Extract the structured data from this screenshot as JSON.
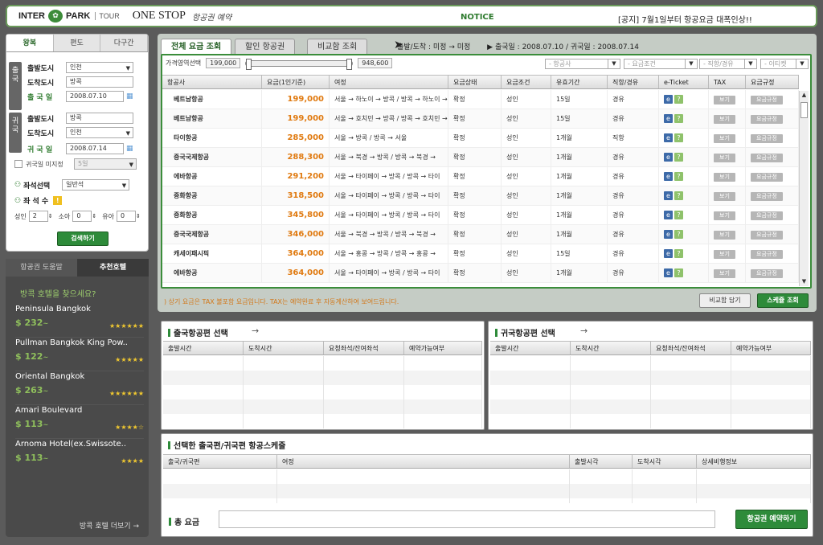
{
  "header": {
    "logo_inter": "INTER",
    "logo_ball": "✿",
    "logo_park": "PARK",
    "logo_tour": "TOUR",
    "logo_onestop": "ONE STOP",
    "logo_sub": "항공권 예약",
    "notice_label": "NOTICE",
    "notice_text": "[공지] 7월1일부터 항공요금 대폭인상!!"
  },
  "left": {
    "tabs": [
      "왕복",
      "편도",
      "다구간"
    ],
    "out_bar": "출국",
    "ret_bar": "귀국",
    "depart_city_label": "출발도시",
    "arrive_city_label": "도착도시",
    "out_date_label": "출 국 일",
    "out_depart_city": "인천",
    "out_arrive_city": "방콕",
    "out_date": "2008.07.10",
    "ret_depart_city_label": "출발도시",
    "ret_arrive_city_label": "도착도시",
    "ret_date_label": "귀 국 일",
    "ret_depart_city": "방콕",
    "ret_arrive_city": "인천",
    "ret_date": "2008.07.14",
    "undecided_label": "귀국일 미지정",
    "undecided_days": "5일",
    "seat_label": "좌석선택",
    "seat_value": "일반석",
    "seatcount_label": "좌 석 수",
    "adult_label": "성인",
    "adult_value": "2",
    "child_label": "소아",
    "child_value": "0",
    "infant_label": "유아",
    "infant_value": "0",
    "search_button": "검색하기"
  },
  "hotels": {
    "tabs": [
      "항공권 도움말",
      "추천호텔"
    ],
    "question": "방콕 호텔을 찾으세요?",
    "items": [
      {
        "name": "Peninsula Bangkok",
        "price": "$ 232",
        "stars": "★★★★★★"
      },
      {
        "name": "Pullman Bangkok King Pow..",
        "price": "$ 122",
        "stars": "★★★★★"
      },
      {
        "name": "Oriental Bangkok",
        "price": "$ 263",
        "stars": "★★★★★★"
      },
      {
        "name": "Amari Boulevard",
        "price": "$ 113",
        "stars": "★★★★☆"
      },
      {
        "name": "Arnoma Hotel(ex.Swissote..",
        "price": "$ 113",
        "stars": "★★★★"
      }
    ],
    "price_suffix": "~",
    "more_link": "방콕 호텔 더보기 →"
  },
  "main": {
    "tabs": [
      "전체 요금 조회",
      "할인 항공권",
      "비교함 조회"
    ],
    "route_text": "출발/도착 : 미정 → 미정",
    "dates_text": "출국일 : 2008.07.10 / 귀국일 : 2008.07.14",
    "price_range_label": "가격영역선택",
    "price_min": "199,000",
    "price_max": "948,600",
    "filters": [
      "- 항공사",
      "- 요금조건",
      "- 직항/경유",
      "- 이티켓"
    ],
    "columns": [
      "항공사",
      "요금(1인기준)",
      "여정",
      "요금상태",
      "요금조건",
      "유효기간",
      "직항/경유",
      "e-Ticket",
      "TAX",
      "요금규정"
    ],
    "view_label": "보기",
    "rule_label": "요금규정",
    "rows": [
      {
        "airline": "베트남항공",
        "price": "199,000",
        "route": "서울 → 하노이 → 방콕 / 방콕 → 하노이 →",
        "status": "확정",
        "cond": "성인",
        "valid": "15일",
        "direct": "경유"
      },
      {
        "airline": "베트남항공",
        "price": "199,000",
        "route": "서울 → 호치민 → 방콕 / 방콕 → 호치민 →",
        "status": "확정",
        "cond": "성인",
        "valid": "15일",
        "direct": "경유"
      },
      {
        "airline": "타이항공",
        "price": "285,000",
        "route": "서울 → 방콕 / 방콕 → 서울",
        "status": "확정",
        "cond": "성인",
        "valid": "1개월",
        "direct": "직항"
      },
      {
        "airline": "중국국제항공",
        "price": "288,300",
        "route": "서울 → 북경 → 방콕 / 방콕 → 북경 →",
        "status": "확정",
        "cond": "성인",
        "valid": "1개월",
        "direct": "경유"
      },
      {
        "airline": "에바항공",
        "price": "291,200",
        "route": "서울 → 타이페이 → 방콕 / 방콕 → 타이",
        "status": "확정",
        "cond": "성인",
        "valid": "1개월",
        "direct": "경유"
      },
      {
        "airline": "중화항공",
        "price": "318,500",
        "route": "서울 → 타이페이 → 방콕 / 방콕 → 타이",
        "status": "확정",
        "cond": "성인",
        "valid": "1개월",
        "direct": "경유"
      },
      {
        "airline": "중화항공",
        "price": "345,800",
        "route": "서울 → 타이페이 → 방콕 / 방콕 → 타이",
        "status": "확정",
        "cond": "성인",
        "valid": "1개월",
        "direct": "경유"
      },
      {
        "airline": "중국국제항공",
        "price": "346,000",
        "route": "서울 → 북경 → 방콕 / 방콕 → 북경 →",
        "status": "확정",
        "cond": "성인",
        "valid": "1개월",
        "direct": "경유"
      },
      {
        "airline": "캐세이패시픽",
        "price": "364,000",
        "route": "서울 → 홍콩 → 방콕 / 방콕 → 홍콩 →",
        "status": "확정",
        "cond": "성인",
        "valid": "15일",
        "direct": "경유"
      },
      {
        "airline": "에바항공",
        "price": "364,000",
        "route": "서울 → 타이페이 → 방콕 / 방콕 → 타이",
        "status": "확정",
        "cond": "성인",
        "valid": "1개월",
        "direct": "경유"
      }
    ],
    "note": ") 상기 요금은 TAX 불포함 요금입니다. TAX는 예약완료 후 자동계산하여 보여드립니다.",
    "compare_button": "비교함 담기",
    "schedule_button": "스케쥴 조회"
  },
  "outbound": {
    "title": "출국항공편 선택",
    "arrow": "→",
    "columns": [
      "출발시간",
      "도착시간",
      "요청좌석/잔여좌석",
      "예약가능여부"
    ]
  },
  "inbound": {
    "title": "귀국항공편 선택",
    "arrow": "→",
    "columns": [
      "출발시간",
      "도착시간",
      "요청좌석/잔여좌석",
      "예약가능여부"
    ]
  },
  "selected": {
    "title": "선택한 출국편/귀국편 항공스케줄",
    "columns": [
      "출국/귀국편",
      "여정",
      "출발시각",
      "도착시각",
      "상세비행정보"
    ]
  },
  "total": {
    "label": "총 요금",
    "book_button": "항공권 예약하기"
  }
}
